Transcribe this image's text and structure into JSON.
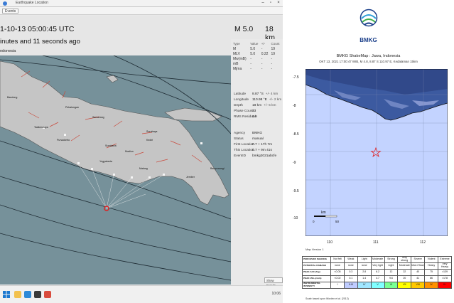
{
  "app": {
    "window_title": "Earthquake Location",
    "toolbar_button": "Events",
    "origin_time_text": "1-10-13 05:00:45 UTC",
    "elapsed_text": "inutes and 11 seconds ago",
    "region_text": "ndonesia",
    "magnitude_text": "M 5.0",
    "depth_text": "18 km",
    "map_places": [
      "Bandung",
      "Tasikmalaya",
      "Pekalongan",
      "Semarang",
      "Purwokerto",
      "Surakarta",
      "Yogyakarta",
      "Kediri",
      "Malang",
      "Surabaya",
      "Madiun",
      "Jember",
      "Banyuwangi"
    ],
    "magnitude_table": {
      "headers": [
        "Type",
        "Value",
        "+/-",
        "Count"
      ],
      "rows": [
        [
          "M",
          "5.0",
          "-",
          "19"
        ],
        [
          "MLV",
          "5.0",
          "0.22",
          "19"
        ],
        [
          "Mw(mB)",
          "-",
          "-",
          "-"
        ],
        [
          "mB",
          "-",
          "-",
          "-"
        ],
        [
          "Mjma",
          "-",
          "-",
          "-"
        ]
      ]
    },
    "origin_info": [
      {
        "key": "Latitude",
        "value": "8.87 °S",
        "unc": "+/- 4 km"
      },
      {
        "key": "Longitude",
        "value": "110.98 °E",
        "unc": "+/- 2 km"
      },
      {
        "key": "Depth",
        "value": "18 km",
        "unc": "+/- 5 km"
      },
      {
        "key": "Phase Count",
        "value": "33",
        "unc": ""
      },
      {
        "key": "RMS Residual",
        "value": "0.9",
        "unc": ""
      }
    ],
    "event_info": [
      {
        "key": "Agency",
        "value": "BMKG"
      },
      {
        "key": "Status",
        "value": "manual"
      },
      {
        "key": "First Location",
        "value": "0.7 + 17h 7m"
      },
      {
        "key": "This Location",
        "value": "0.7 + 9m 41s"
      },
      {
        "key": "EventID",
        "value": "bmkg2021abcfe"
      }
    ],
    "show_details_label": "Show Details",
    "tray_time": "10:06"
  },
  "shakemap": {
    "logo_text": "BMKG",
    "title": "BMKG ShakeMap : Jawa, Indonesia",
    "subtitle": "OKT 13, 2021 17:00:47 WIB, M 4.8, 8.87 S 110.97 E, Kedalaman 15km",
    "lat_labels": [
      "-7.5",
      "-8",
      "-8.5",
      "-9",
      "-9.5",
      "-10"
    ],
    "lon_labels": [
      "110",
      "111",
      "112"
    ],
    "scale_unit": "km",
    "scale_ticks": [
      "0",
      "50"
    ],
    "map_version": "Map Version 1",
    "legend_rows": [
      {
        "label": "PERCEIVED SHAKING",
        "cells": [
          "Not felt",
          "Weak",
          "Light",
          "Moderate",
          "Strong",
          "Very strong",
          "Severe",
          "Violent",
          "Extreme"
        ]
      },
      {
        "label": "POTENTIAL DAMAGE",
        "cells": [
          "none",
          "none",
          "none",
          "Very light",
          "Light",
          "Moderate",
          "Mod./Heavy",
          "Heavy",
          "Very Heavy"
        ]
      },
      {
        "label": "PEAK ACC.(%g)",
        "cells": [
          "<0.05",
          "0.3",
          "2.8",
          "6.2",
          "12",
          "22",
          "40",
          "75",
          ">139"
        ]
      },
      {
        "label": "PEAK VEL.(cm/s)",
        "cells": [
          "<0.02",
          "0.1",
          "1.4",
          "4.7",
          "9.6",
          "20",
          "41",
          "86",
          ">178"
        ]
      },
      {
        "label": "INSTRUMENTAL INTENSITY",
        "cells": [
          "I",
          "II-III",
          "IV",
          "V",
          "VI",
          "VII",
          "VIII",
          "IX",
          "X+"
        ]
      }
    ],
    "intensity_colors": [
      "#ffffff",
      "#bfccff",
      "#a0e6ff",
      "#80ffff",
      "#7aff93",
      "#ffff00",
      "#ffc800",
      "#ff9100",
      "#ff0000"
    ],
    "footnote": "Scale based upon Worden et al. (2012)"
  }
}
